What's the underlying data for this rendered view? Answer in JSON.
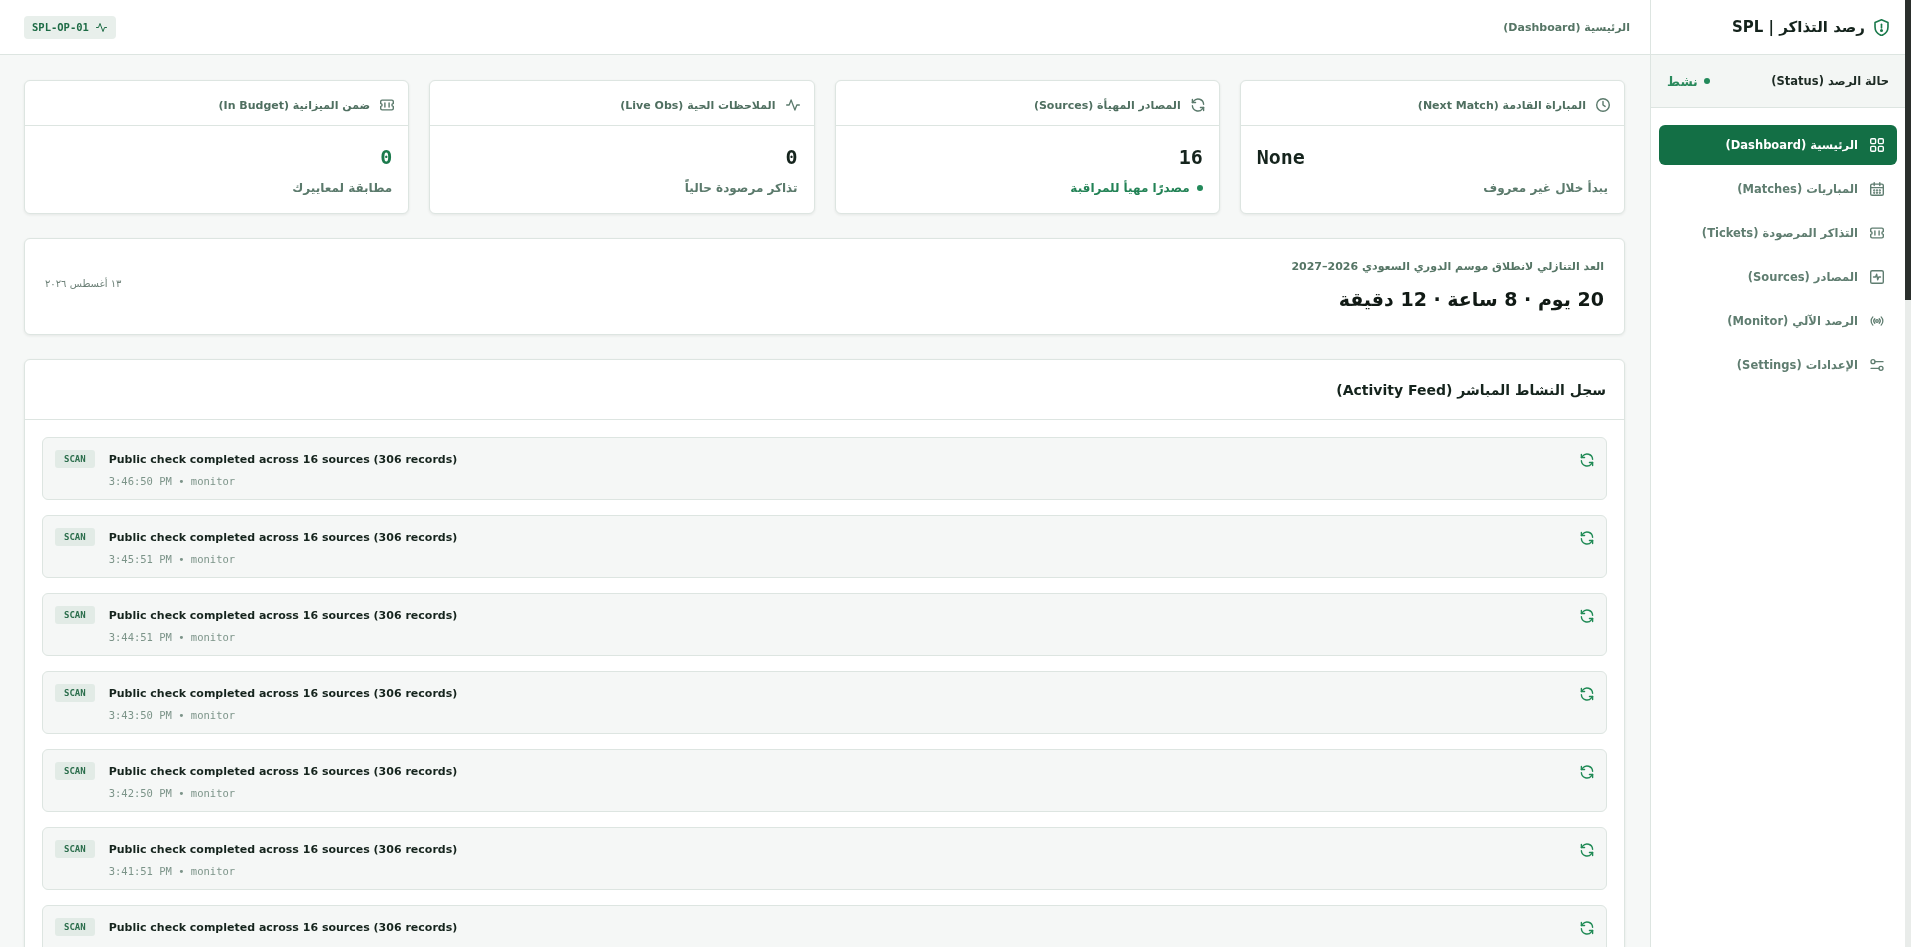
{
  "sidebar": {
    "title": "رصد التذاكر | SPL",
    "status": {
      "label": "حالة الرصد (Status)",
      "value": "نشط",
      "on": true
    },
    "nav": [
      {
        "kind": "dashboard",
        "label": "الرئيسية (Dashboard)",
        "selected": true
      },
      {
        "kind": "matches",
        "label": "المباريات (Matches)",
        "selected": false
      },
      {
        "kind": "tickets",
        "label": "التذاكر المرصودة (Tickets)",
        "selected": false
      },
      {
        "kind": "sources",
        "label": "المصادر (Sources)",
        "selected": false
      },
      {
        "kind": "monitor",
        "label": "الرصد الآلي (Monitor)",
        "selected": false
      },
      {
        "kind": "settings",
        "label": "الإعدادات (Settings)",
        "selected": false
      }
    ]
  },
  "topbar": {
    "breadcrumb": "الرئيسية (Dashboard)",
    "station": "SPL-OP-01"
  },
  "cards": [
    {
      "kind": "next_match",
      "title": "المباراة القادمة (Next Match)",
      "value": "None",
      "value_accent": false,
      "note": "يبدأ خلال غير معروف",
      "note_active": false
    },
    {
      "kind": "sources",
      "title": "المصادر المهيأة (Sources)",
      "value": "16",
      "value_accent": false,
      "note": "مصدرًا مهيأ للمراقبة",
      "note_active": true
    },
    {
      "kind": "live_obs",
      "title": "الملاحظات الحية (Live Obs)",
      "value": "0",
      "value_accent": false,
      "note": "تذاكر مرصودة حالياً",
      "note_active": false
    },
    {
      "kind": "budget",
      "title": "ضمن الميزانية (In Budget)",
      "value": "0",
      "value_accent": true,
      "note": "مطابقة لمعاييرك",
      "note_active": false
    }
  ],
  "countdown": {
    "title": "العد التنازلي لانطلاق موسم الدوري السعودي 2026–2027",
    "value": "20 يوم · 8 ساعة · 12 دقيقة",
    "date": "١٣ أغسطس ٢٠٢٦"
  },
  "activity": {
    "title": "سجل النشاط المباشر (Activity Feed)",
    "items": [
      {
        "kind": "scan",
        "message": "Public check completed across 16 sources (306 records)",
        "meta": "3:46:50 PM • monitor",
        "tag": "SCAN"
      },
      {
        "kind": "scan",
        "message": "Public check completed across 16 sources (306 records)",
        "meta": "3:45:51 PM • monitor",
        "tag": "SCAN"
      },
      {
        "kind": "scan",
        "message": "Public check completed across 16 sources (306 records)",
        "meta": "3:44:51 PM • monitor",
        "tag": "SCAN"
      },
      {
        "kind": "scan",
        "message": "Public check completed across 16 sources (306 records)",
        "meta": "3:43:50 PM • monitor",
        "tag": "SCAN"
      },
      {
        "kind": "scan",
        "message": "Public check completed across 16 sources (306 records)",
        "meta": "3:42:50 PM • monitor",
        "tag": "SCAN"
      },
      {
        "kind": "scan",
        "message": "Public check completed across 16 sources (306 records)",
        "meta": "3:41:51 PM • monitor",
        "tag": "SCAN"
      },
      {
        "kind": "scan",
        "message": "Public check completed across 16 sources (306 records)",
        "tag": "SCAN"
      }
    ]
  }
}
